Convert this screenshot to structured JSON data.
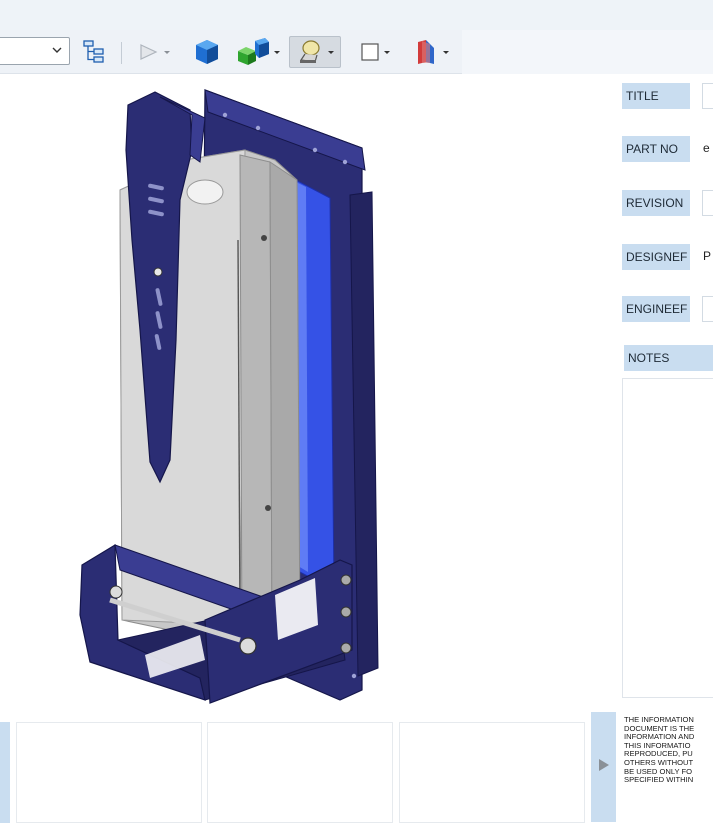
{
  "toolbar": {
    "combo_value": "",
    "icons": [
      "tree-icon",
      "play-icon",
      "cube-icon",
      "multi-cube-icon",
      "light-icon",
      "square-outline-icon",
      "section-icon"
    ]
  },
  "form": {
    "title_label": "TITLE",
    "title_value": "",
    "partno_label": "PART NO",
    "partno_value": "e",
    "revision_label": "REVISION",
    "revision_value": "",
    "designer_label": "DESIGNEF",
    "designer_value": "P",
    "engineer_label": "ENGINEEF",
    "engineer_value": "",
    "notes_label": "NOTES",
    "notes_value": ""
  },
  "legal": {
    "lines": [
      "THE INFORMATION",
      "DOCUMENT IS THE",
      "INFORMATION AND",
      "THIS INFORMATIO",
      "REPRODUCED, PU",
      "OTHERS WITHOUT",
      "BE USED ONLY FO",
      "SPECIFIED WITHIN"
    ]
  },
  "colors": {
    "accent_blue": "#c9ddf0",
    "model_navy": "#2d2f7a",
    "model_blue": "#3b5bea",
    "model_grey": "#c9c9c9"
  }
}
